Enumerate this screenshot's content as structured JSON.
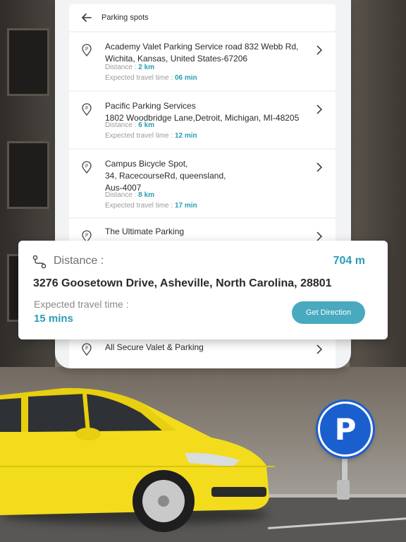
{
  "header": {
    "title": "Parking spots",
    "back_icon": "arrow-left-icon"
  },
  "items": [
    {
      "name": "Academy Valet Parking Service road 832 Webb Rd, Wichita, Kansas, United States-67206",
      "distance_label": "Distance : ",
      "distance": "2 km",
      "time_label": "Expected travel time : ",
      "time": "06 min"
    },
    {
      "name": "Pacific Parking Services\n1802 Woodbridge Lane,Detroit, Michigan, MI-48205",
      "distance_label": "Distance : ",
      "distance": "6 km",
      "time_label": "Expected travel time : ",
      "time": "12 min"
    },
    {
      "name": "Campus Bicycle Spot,\n34, RacecourseRd, queensland,\nAus-4007",
      "distance_label": "Distance : ",
      "distance": "8 km",
      "time_label": "Expected travel time : ",
      "time": "17 min"
    },
    {
      "name": "The Ultimate Parking"
    },
    {
      "name": "All Secure Valet & Parking"
    }
  ],
  "card": {
    "distance_label": "Distance :",
    "distance_value": "704 m",
    "address": "3276 Goosetown Drive, Asheville, North Carolina, 28801",
    "time_label": "Expected travel time :",
    "time_value": "15 mins",
    "button_label": "Get Direction",
    "route_icon": "route-icon"
  },
  "sign": {
    "letter": "P"
  },
  "colors": {
    "accent": "#2a9db5",
    "button": "#48a9bf",
    "sign": "#1b5fcf",
    "car": "#f2dc1c"
  }
}
